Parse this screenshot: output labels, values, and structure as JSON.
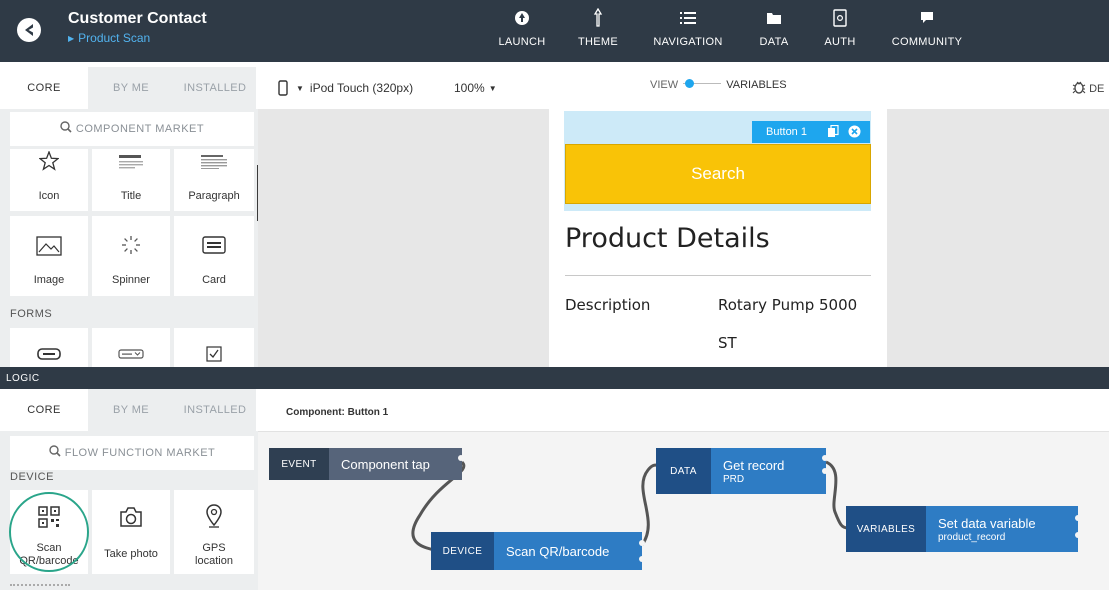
{
  "app": {
    "title": "Customer Contact",
    "breadcrumb": "Product Scan"
  },
  "nav": [
    {
      "label": "LAUNCH",
      "icon": "rocket-icon"
    },
    {
      "label": "THEME",
      "icon": "brush-icon"
    },
    {
      "label": "NAVIGATION",
      "icon": "list-icon"
    },
    {
      "label": "DATA",
      "icon": "folder-icon"
    },
    {
      "label": "AUTH",
      "icon": "lock-icon"
    },
    {
      "label": "COMMUNITY",
      "icon": "chat-icon"
    }
  ],
  "ui_panel": {
    "tabs": [
      "CORE",
      "BY ME",
      "INSTALLED"
    ],
    "market_placeholder": "COMPONENT MARKET",
    "components": [
      {
        "label": "Icon",
        "icon": "star-icon"
      },
      {
        "label": "Title",
        "icon": "title-icon"
      },
      {
        "label": "Paragraph",
        "icon": "paragraph-icon"
      },
      {
        "label": "Image",
        "icon": "image-icon"
      },
      {
        "label": "Spinner",
        "icon": "spinner-icon"
      },
      {
        "label": "Card",
        "icon": "card-icon"
      }
    ],
    "forms_label": "FORMS"
  },
  "toolbar": {
    "device": "iPod Touch (320px)",
    "zoom": "100%",
    "view_label": "VIEW",
    "variables_label": "VARIABLES",
    "debug_label": "DE"
  },
  "canvas": {
    "selected_tag": "Button 1",
    "search_button": "Search",
    "product_title": "Product Details",
    "description_label": "Description",
    "description_value_line1": "Rotary Pump 5000",
    "description_value_line2": "ST"
  },
  "logic": {
    "bar_label": "LOGIC",
    "tabs": [
      "CORE",
      "BY ME",
      "INSTALLED"
    ],
    "market_placeholder": "FLOW FUNCTION MARKET",
    "device_label": "DEVICE",
    "functions": [
      {
        "label_line1": "Scan",
        "label_line2": "QR/barcode",
        "icon": "qr-code-icon"
      },
      {
        "label_line1": "Take photo",
        "label_line2": "",
        "icon": "camera-icon"
      },
      {
        "label_line1": "GPS",
        "label_line2": "location",
        "icon": "location-pin-icon"
      }
    ],
    "component_header": "Component: Button 1",
    "nodes": {
      "event": {
        "tag": "EVENT",
        "title": "Component tap"
      },
      "device": {
        "tag": "DEVICE",
        "title": "Scan QR/barcode"
      },
      "data": {
        "tag": "DATA",
        "title": "Get record",
        "sub": "PRD"
      },
      "variables": {
        "tag": "VARIABLES",
        "title": "Set data variable",
        "sub": "product_record"
      }
    }
  },
  "colors": {
    "header_bg": "#2f3a46",
    "accent_blue": "#1ea6ee",
    "search_yellow": "#f9c307",
    "node_blue": "#2e7cc4",
    "highlight_green": "#2aa58a"
  }
}
